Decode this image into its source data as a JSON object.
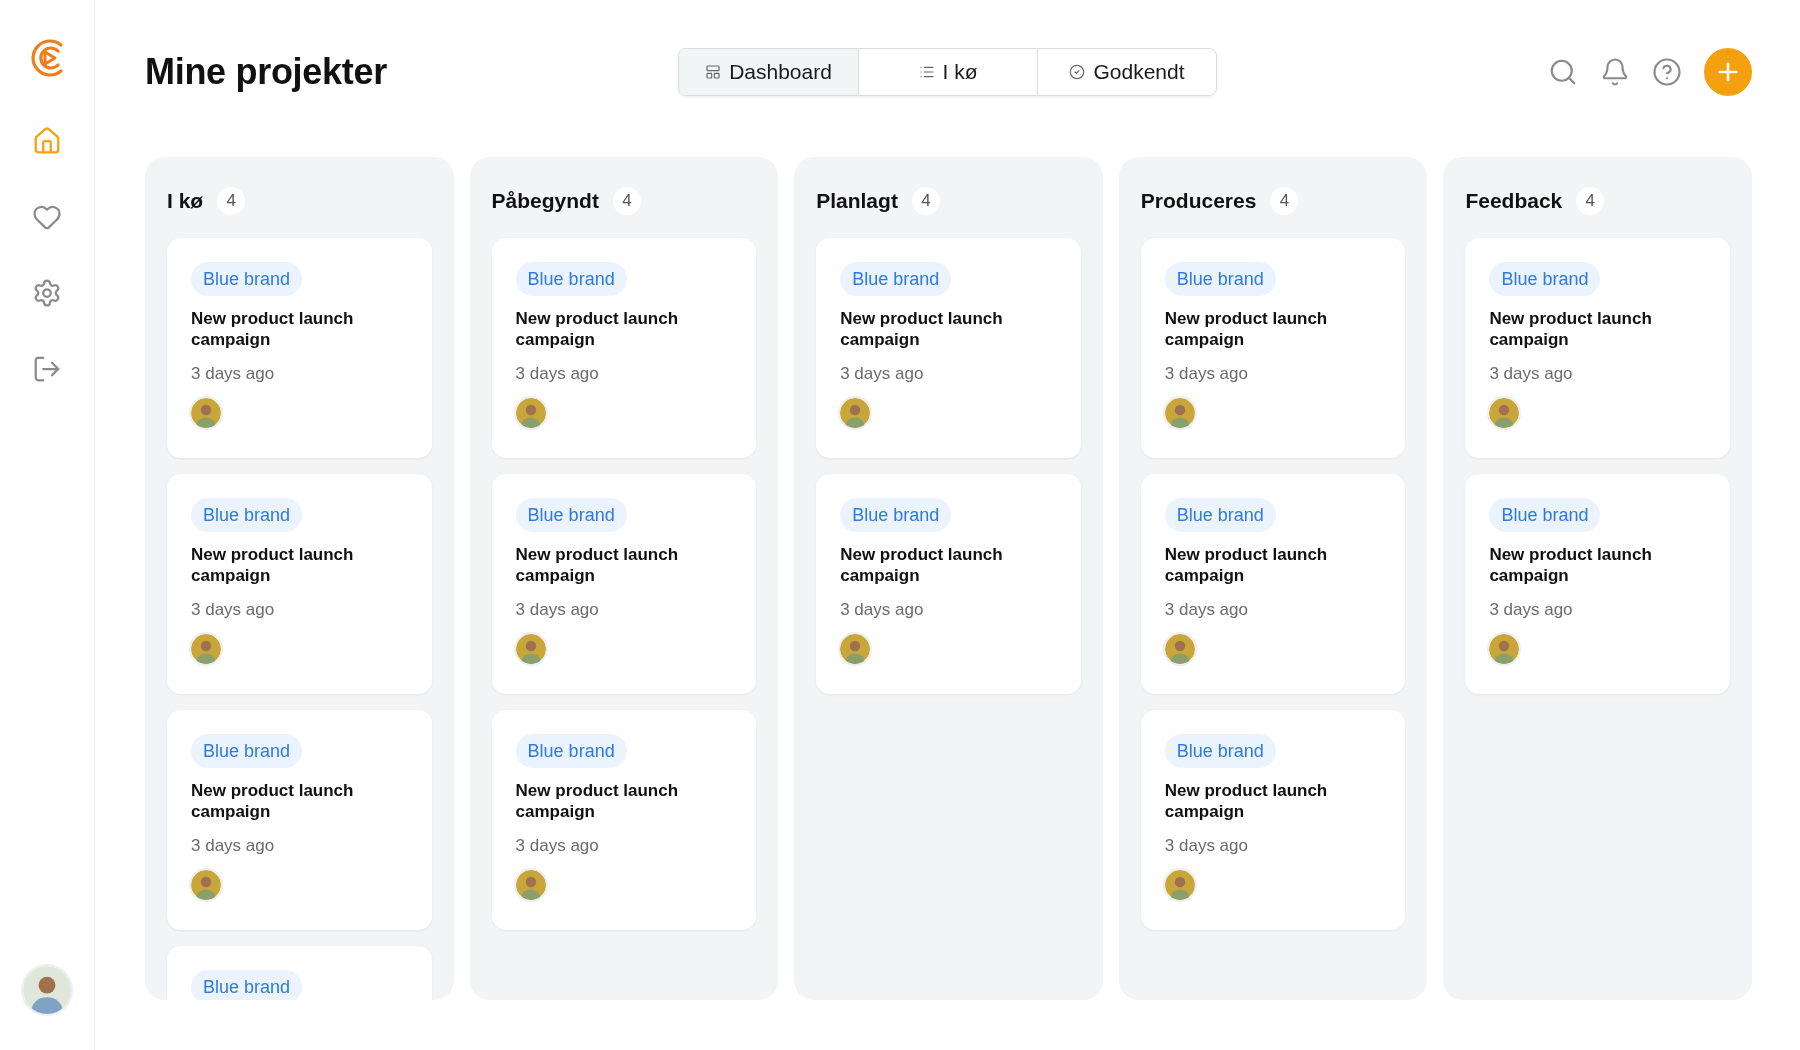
{
  "sidebar": {
    "items": [
      {
        "kind": "home",
        "selected": true
      },
      {
        "kind": "heart",
        "selected": false
      },
      {
        "kind": "settings",
        "selected": false
      },
      {
        "kind": "logout",
        "selected": false
      }
    ]
  },
  "header": {
    "title": "Mine projekter",
    "tabs": [
      {
        "kind": "board",
        "label": "Dashboard",
        "selected": true
      },
      {
        "kind": "list",
        "label": "I kø",
        "selected": false
      },
      {
        "kind": "check",
        "label": "Godkendt",
        "selected": false
      }
    ]
  },
  "columns": [
    {
      "title": "I kø",
      "count": "4",
      "cards": [
        {
          "tag": "Blue brand",
          "title": "New product launch campaign",
          "time": "3 days ago"
        },
        {
          "tag": "Blue brand",
          "title": "New product launch campaign",
          "time": "3 days ago"
        },
        {
          "tag": "Blue brand",
          "title": "New product launch campaign",
          "time": "3 days ago"
        },
        {
          "tag": "Blue brand"
        }
      ]
    },
    {
      "title": "Påbegyndt",
      "count": "4",
      "cards": [
        {
          "tag": "Blue brand",
          "title": "New product launch campaign",
          "time": "3 days ago"
        },
        {
          "tag": "Blue brand",
          "title": "New product launch campaign",
          "time": "3 days ago"
        },
        {
          "tag": "Blue brand",
          "title": "New product launch campaign",
          "time": "3 days ago"
        }
      ]
    },
    {
      "title": "Planlagt",
      "count": "4",
      "cards": [
        {
          "tag": "Blue brand",
          "title": "New product launch campaign",
          "time": "3 days ago"
        },
        {
          "tag": "Blue brand",
          "title": "New product launch campaign",
          "time": "3 days ago"
        }
      ]
    },
    {
      "title": "Produceres",
      "count": "4",
      "cards": [
        {
          "tag": "Blue brand",
          "title": "New product launch campaign",
          "time": "3 days ago"
        },
        {
          "tag": "Blue brand",
          "title": "New product launch campaign",
          "time": "3 days ago"
        },
        {
          "tag": "Blue brand",
          "title": "New product launch campaign",
          "time": "3 days ago"
        }
      ]
    },
    {
      "title": "Feedback",
      "count": "4",
      "cards": [
        {
          "tag": "Blue brand",
          "title": "New product launch campaign",
          "time": "3 days ago"
        },
        {
          "tag": "Blue brand",
          "title": "New product launch campaign",
          "time": "3 days ago"
        }
      ]
    }
  ]
}
